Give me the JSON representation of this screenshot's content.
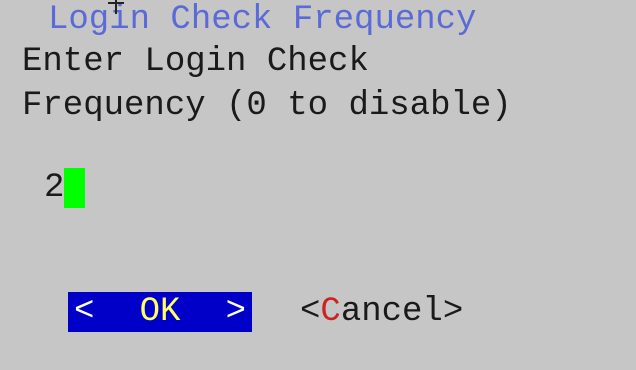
{
  "dialog": {
    "title": "Login Check Frequency",
    "prompt_line1": "Enter Login Check",
    "prompt_line2": "Frequency (0 to disable)",
    "input_value": "2"
  },
  "buttons": {
    "ok": {
      "left_bracket": "<",
      "label": "OK",
      "right_bracket": ">"
    },
    "cancel": {
      "prefix": "<",
      "hotkey": "C",
      "rest": "ancel",
      "suffix": ">"
    }
  },
  "colors": {
    "background": "#c6c6c6",
    "title": "#5a6ad6",
    "selected_button_bg": "#0000c8",
    "selected_button_text": "#ffff66",
    "hotkey": "#cc2222",
    "caret": "#00ff00"
  }
}
